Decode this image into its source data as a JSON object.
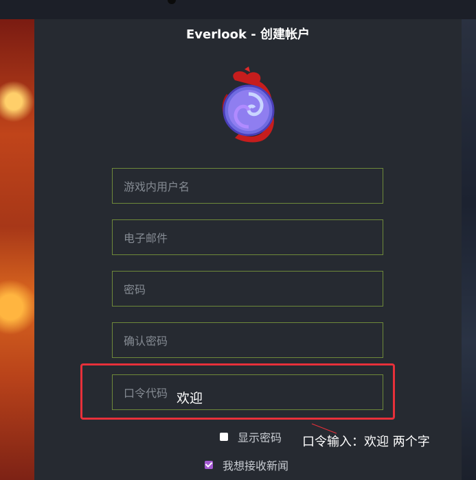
{
  "title": "Everlook - 创建帐户",
  "fields": [
    {
      "placeholder": "游戏内用户名",
      "value": ""
    },
    {
      "placeholder": "电子邮件",
      "value": ""
    },
    {
      "placeholder": "密码",
      "value": ""
    },
    {
      "placeholder": "确认密码",
      "value": ""
    },
    {
      "placeholder": "口令代码",
      "value": "欢迎"
    }
  ],
  "checkboxes": [
    {
      "label": "显示密码",
      "checked": false
    },
    {
      "label": "我想接收新闻",
      "checked": true
    }
  ],
  "annotation": {
    "note": "口令输入：欢迎  两个字",
    "highlight_color": "#e8303a"
  },
  "colors": {
    "panel_bg": "#262a31",
    "field_border": "#6f8a3a",
    "checkbox_accent": "#a45ad2"
  },
  "icons": {
    "logo": "dragon-hearthstone-logo-icon"
  }
}
